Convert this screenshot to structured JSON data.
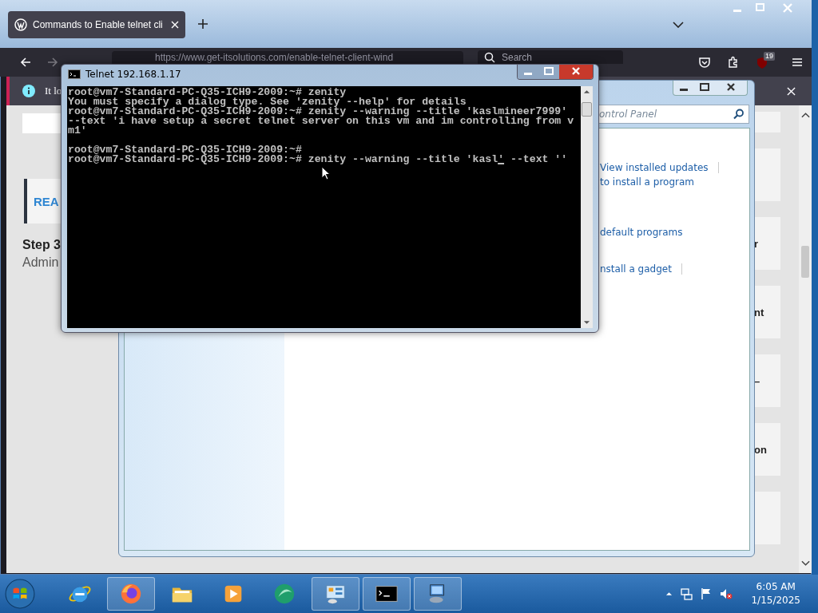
{
  "browser": {
    "tab": {
      "title": "Commands to Enable telnet cli",
      "selected": true
    },
    "url": "https://www.get-itsolutions.com/enable-telnet-client-wind",
    "search": {
      "placeholder": "Search"
    },
    "badge": "19",
    "notice": "It lo",
    "content": {
      "left": [
        {
          "kind": "box"
        },
        {
          "kind": "callout",
          "text": "REA"
        },
        {
          "kind": "heading",
          "text": "Step 3"
        },
        {
          "kind": "paragraph",
          "text": "Admin"
        }
      ],
      "cards": [
        {
          "kind": "blank"
        },
        {
          "kind": "blank"
        },
        {
          "kind": "titled",
          "text": "r"
        },
        {
          "kind": "titled",
          "text": "nt"
        },
        {
          "kind": "titled",
          "text": "–"
        },
        {
          "kind": "titled",
          "text": "on"
        },
        {
          "kind": "blank"
        }
      ]
    }
  },
  "control_panel": {
    "search": {
      "placeholder": "ontrol Panel"
    },
    "links": [
      {
        "text": "View installed updates",
        "separator": true
      },
      {
        "text": "to install a program",
        "separator": false
      },
      {
        "text": "default programs",
        "separator": false
      },
      {
        "text": "nstall a gadget",
        "separator": true
      }
    ]
  },
  "telnet": {
    "title": "Telnet 192.168.1.17",
    "blocks": [
      {
        "lines": [
          {
            "text": "root@vm7-Standard-PC-Q35-ICH9-2009:~# zenity"
          },
          {
            "text": "You must specify a dialog type. See 'zenity --help' for details"
          },
          {
            "text": "root@vm7-Standard-PC-Q35-ICH9-2009:~# zenity --warning --title 'kaslmineer7999'"
          },
          {
            "text": "--text 'i have setup a secret telnet server on this vm and im controlling from v"
          },
          {
            "text": "m1'"
          }
        ]
      },
      {
        "lines": [
          {
            "text": "root@vm7-Standard-PC-Q35-ICH9-2009:~#"
          },
          {
            "text": "root@vm7-Standard-PC-Q35-ICH9-2009:~# zenity --warning --title 'kasl",
            "cursor_text": "' --text ''"
          }
        ]
      }
    ]
  },
  "taskbar": {
    "items": [
      {
        "kind": "ie",
        "running": false
      },
      {
        "kind": "firefox",
        "running": true
      },
      {
        "kind": "folder",
        "running": false
      },
      {
        "kind": "media",
        "running": false
      },
      {
        "kind": "green",
        "running": false
      },
      {
        "kind": "control",
        "running": true
      },
      {
        "kind": "cmd",
        "running": true
      },
      {
        "kind": "network",
        "running": true
      }
    ],
    "time": "6:05 AM",
    "date": "1/15/2025"
  }
}
